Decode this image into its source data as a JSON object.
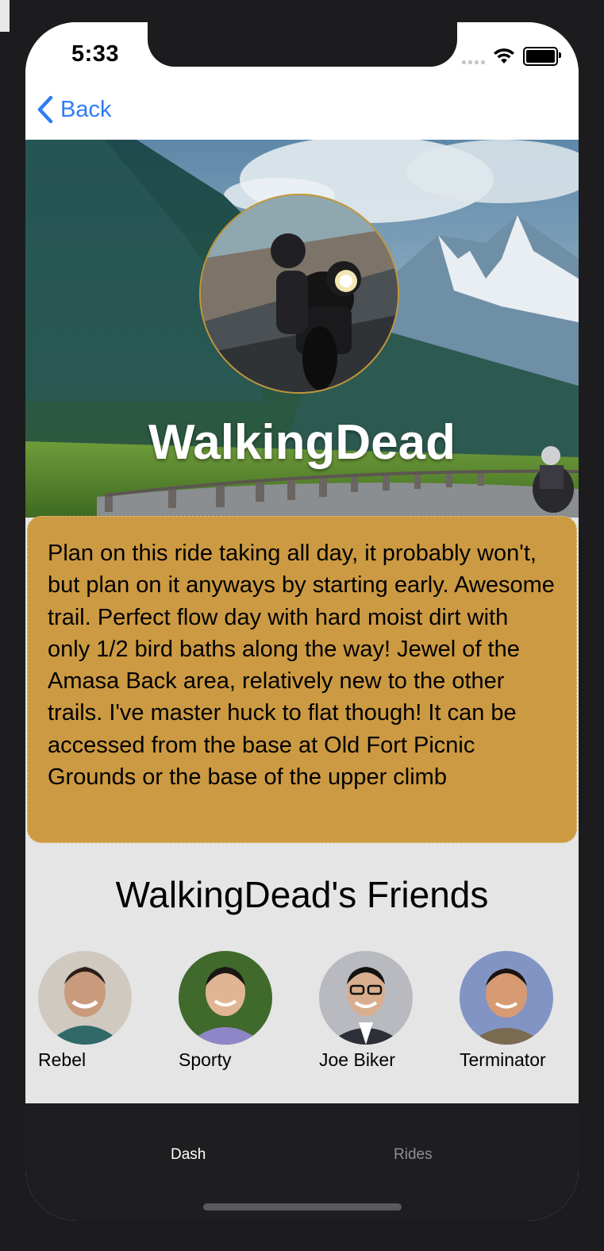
{
  "status_bar": {
    "time": "5:33"
  },
  "nav": {
    "back_label": "Back"
  },
  "profile": {
    "username": "WalkingDead",
    "description": "Plan on this ride taking all day, it probably won't, but plan on it anyways by starting early. Awesome trail. Perfect flow day with hard moist dirt with only 1/2 bird baths along the way! Jewel of the Amasa Back area, relatively new to the other trails. I've master huck to flat though!  It can be accessed from the base at Old Fort Picnic Grounds or the base of the upper climb"
  },
  "friends": {
    "title": "WalkingDead's Friends",
    "items": [
      {
        "name": "Rebel"
      },
      {
        "name": "Sporty"
      },
      {
        "name": "Joe Biker"
      },
      {
        "name": "Terminator"
      }
    ]
  },
  "tabs": [
    {
      "label": "Dash",
      "active": true
    },
    {
      "label": "Rides",
      "active": false
    }
  ],
  "colors": {
    "accent_blue": "#2f7cf6",
    "card_gold": "#cc9a42",
    "tab_active": "#ffffff",
    "tab_inactive": "#8e8e93"
  }
}
